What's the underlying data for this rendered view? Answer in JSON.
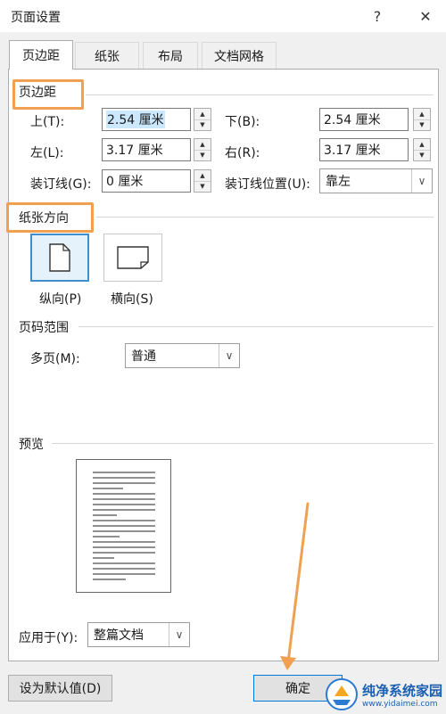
{
  "window": {
    "title": "页面设置",
    "help": "?",
    "close": "✕"
  },
  "tabs": [
    "页边距",
    "纸张",
    "布局",
    "文档网格"
  ],
  "margins": {
    "section": "页边距",
    "top_label": "上(T):",
    "top_value": "2.54 厘米",
    "bottom_label": "下(B):",
    "bottom_value": "2.54 厘米",
    "left_label": "左(L):",
    "left_value": "3.17 厘米",
    "right_label": "右(R):",
    "right_value": "3.17 厘米",
    "gutter_label": "装订线(G):",
    "gutter_value": "0 厘米",
    "gutter_pos_label": "装订线位置(U):",
    "gutter_pos_value": "靠左"
  },
  "orientation": {
    "section": "纸张方向",
    "portrait": "纵向(P)",
    "landscape": "横向(S)",
    "selected": "portrait"
  },
  "pages": {
    "section": "页码范围",
    "multi_label": "多页(M):",
    "multi_value": "普通"
  },
  "preview": {
    "section": "预览",
    "apply_label": "应用于(Y):",
    "apply_value": "整篇文档"
  },
  "footer": {
    "default_button": "设为默认值(D)",
    "ok_button": "确定"
  },
  "watermark": {
    "name": "纯净系统家园",
    "url": "www.yidaimei.com"
  },
  "colors": {
    "annotation": "#f0a050",
    "selection": "#cce8ff",
    "focus_border": "#0078d7"
  }
}
